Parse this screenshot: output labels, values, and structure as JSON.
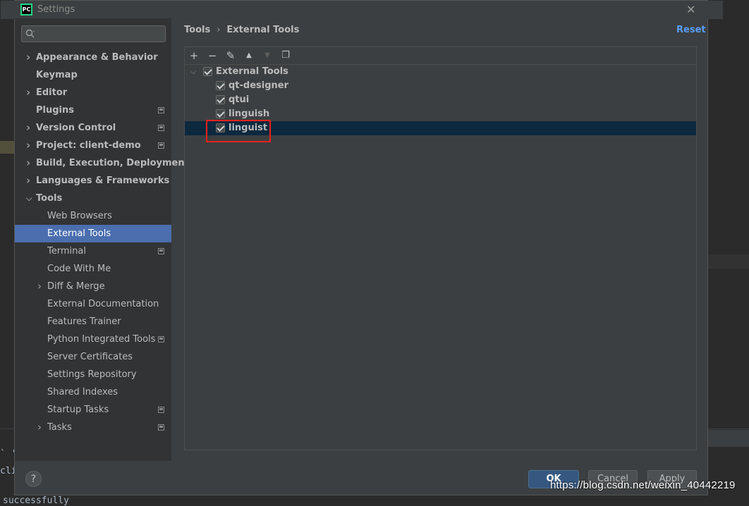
{
  "window": {
    "title": "Settings",
    "logo_text": "PC",
    "close_glyph": "✕"
  },
  "search": {
    "placeholder": ""
  },
  "nav": {
    "items": [
      {
        "label": "Appearance & Behavior",
        "expandable": true,
        "indent": 0,
        "bold": true,
        "project": false
      },
      {
        "label": "Keymap",
        "expandable": false,
        "indent": 0,
        "bold": true,
        "project": false
      },
      {
        "label": "Editor",
        "expandable": true,
        "indent": 0,
        "bold": true,
        "project": false
      },
      {
        "label": "Plugins",
        "expandable": false,
        "indent": 0,
        "bold": true,
        "project": true
      },
      {
        "label": "Version Control",
        "expandable": true,
        "indent": 0,
        "bold": true,
        "project": true
      },
      {
        "label": "Project: client-demo",
        "expandable": true,
        "indent": 0,
        "bold": true,
        "project": true
      },
      {
        "label": "Build, Execution, Deployment",
        "expandable": true,
        "indent": 0,
        "bold": true,
        "project": false
      },
      {
        "label": "Languages & Frameworks",
        "expandable": true,
        "indent": 0,
        "bold": true,
        "project": false
      },
      {
        "label": "Tools",
        "expandable": true,
        "expanded": true,
        "indent": 0,
        "bold": true,
        "project": false
      },
      {
        "label": "Web Browsers",
        "expandable": false,
        "indent": 1,
        "bold": false,
        "project": false
      },
      {
        "label": "External Tools",
        "expandable": false,
        "indent": 1,
        "bold": false,
        "project": false,
        "selected": true
      },
      {
        "label": "Terminal",
        "expandable": false,
        "indent": 1,
        "bold": false,
        "project": true
      },
      {
        "label": "Code With Me",
        "expandable": false,
        "indent": 1,
        "bold": false,
        "project": false
      },
      {
        "label": "Diff & Merge",
        "expandable": true,
        "indent": 1,
        "bold": false,
        "project": false
      },
      {
        "label": "External Documentation",
        "expandable": false,
        "indent": 1,
        "bold": false,
        "project": false
      },
      {
        "label": "Features Trainer",
        "expandable": false,
        "indent": 1,
        "bold": false,
        "project": false
      },
      {
        "label": "Python Integrated Tools",
        "expandable": false,
        "indent": 1,
        "bold": false,
        "project": true
      },
      {
        "label": "Server Certificates",
        "expandable": false,
        "indent": 1,
        "bold": false,
        "project": false
      },
      {
        "label": "Settings Repository",
        "expandable": false,
        "indent": 1,
        "bold": false,
        "project": false
      },
      {
        "label": "Shared Indexes",
        "expandable": false,
        "indent": 1,
        "bold": false,
        "project": false
      },
      {
        "label": "Startup Tasks",
        "expandable": false,
        "indent": 1,
        "bold": false,
        "project": true
      },
      {
        "label": "Tasks",
        "expandable": true,
        "indent": 1,
        "bold": false,
        "project": true
      }
    ]
  },
  "breadcrumb": {
    "parent": "Tools",
    "separator": "›",
    "current": "External Tools"
  },
  "reset_label": "Reset",
  "toolbar": {
    "add_glyph": "+",
    "remove_glyph": "−",
    "edit_glyph": "✎",
    "up_glyph": "▲",
    "down_glyph": "▼",
    "copy_glyph": "❐"
  },
  "tree": {
    "group": {
      "label": "External Tools",
      "checked": true,
      "expanded": true
    },
    "tools": [
      {
        "label": "qt-designer",
        "checked": true
      },
      {
        "label": "qtui",
        "checked": true
      },
      {
        "label": "linguish",
        "checked": true
      },
      {
        "label": "linguist",
        "checked": true,
        "selected": true
      }
    ]
  },
  "buttons": {
    "help": "?",
    "ok": "OK",
    "cancel": "Cancel",
    "apply": "Apply"
  },
  "background": {
    "terminal_lines": [
      "` '",
      "cli",
      "successfully"
    ]
  },
  "watermark": "https://blog.csdn.net/weixin_40442219",
  "colors": {
    "selection": "#4b6eaf",
    "tree_selection": "#0d293e",
    "link": "#589df6",
    "ok_button": "#365880",
    "highlight_box": "#e8221e"
  }
}
